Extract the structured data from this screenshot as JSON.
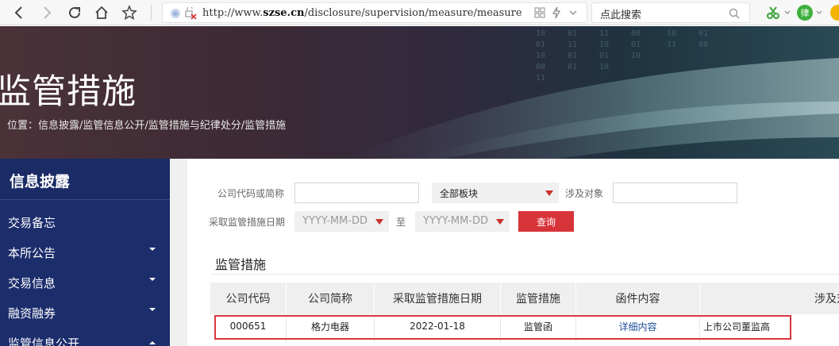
{
  "browser": {
    "url_prefix": "http://www.",
    "url_domain": "szse.cn",
    "url_path": "/disclosure/supervision/measure/measure",
    "search_placeholder": "点此搜索",
    "profile_letter": "律"
  },
  "banner": {
    "title": "监管措施",
    "breadcrumb": "位置：信息披露/监管信息公开/监管措施与纪律处分/监管措施"
  },
  "sidebar": {
    "title": "信息披露",
    "items": [
      {
        "label": "交易备忘",
        "caret": ""
      },
      {
        "label": "本所公告",
        "caret": "down"
      },
      {
        "label": "交易信息",
        "caret": "down"
      },
      {
        "label": "融资融券",
        "caret": "down"
      },
      {
        "label": "监管信息公开",
        "caret": "up"
      }
    ]
  },
  "filters": {
    "company_label": "公司代码或简称",
    "company_value": "",
    "board_value": "全部板块",
    "target_label": "涉及对象",
    "target_value": "",
    "date_label": "采取监管措施日期",
    "date_start_placeholder": "YYYY-MM-DD",
    "date_to": "至",
    "date_end_placeholder": "YYYY-MM-DD",
    "query_label": "查询"
  },
  "section_title": "监管措施",
  "table": {
    "headers": [
      "公司代码",
      "公司简称",
      "采取监管措施日期",
      "监管措施",
      "函件内容",
      "涉及对象"
    ],
    "rows": [
      [
        "000651",
        "格力电器",
        "2022-01-18",
        "监管函",
        "详细内容",
        "上市公司董监高"
      ]
    ]
  },
  "colors": {
    "sidebar_bg": "#1c2d6c",
    "query_button": "#d7343a",
    "link": "#1f4e9c",
    "highlight": "#d9363e"
  }
}
